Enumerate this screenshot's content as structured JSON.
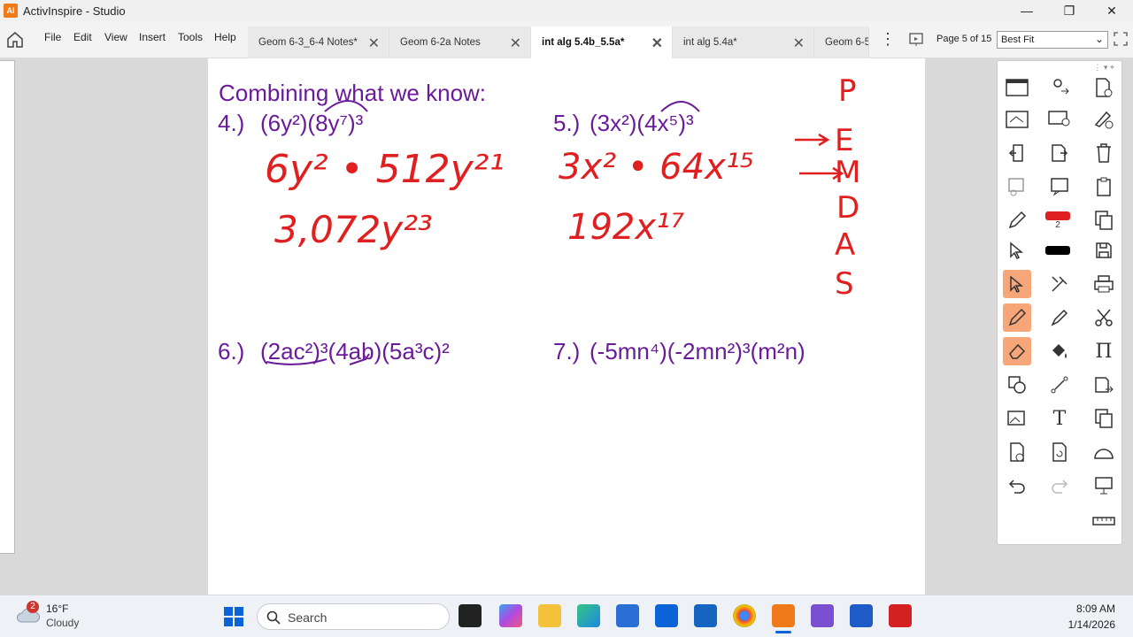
{
  "window": {
    "title": "ActivInspire - Studio",
    "logo_text": "AI"
  },
  "menu": [
    "File",
    "Edit",
    "View",
    "Insert",
    "Tools",
    "Help"
  ],
  "tabs": [
    {
      "label": "Geom 6-3_6-4 Notes*",
      "active": false
    },
    {
      "label": "Geom 6-2a Notes",
      "active": false
    },
    {
      "label": "int alg 5.4b_5.5a*",
      "active": true
    },
    {
      "label": "int alg 5.4a*",
      "active": false
    },
    {
      "label": "Geom 6-5",
      "active": false
    }
  ],
  "page_indicator": "Page 5 of 15",
  "zoom": "Best Fit",
  "flipchart": {
    "heading": "Combining what we know:",
    "problems": [
      {
        "num": "4.)",
        "expr": "(6y²)(8y⁷)³"
      },
      {
        "num": "5.)",
        "expr": "(3x²)(4x⁵)³"
      },
      {
        "num": "6.)",
        "expr": "(2ac²)³(4ab)(5a³c)²"
      },
      {
        "num": "7.)",
        "expr": "(-5mn⁴)(-2mn²)³(m²n)"
      }
    ],
    "handwritten": {
      "p4_step1": "6y² • 512y²¹",
      "p4_step2": "3,072y²³",
      "p5_step1": "3x² • 64x¹⁵",
      "p5_step2": "192x¹⁷",
      "pemdas": [
        "P",
        "E",
        "M",
        "D",
        "A",
        "S"
      ]
    }
  },
  "colors": {
    "typed_text": "#6a1b9a",
    "ink": "#e02020",
    "accent_tool": "#f7a67a"
  },
  "pen_width": "2",
  "taskbar": {
    "weather_temp": "16°F",
    "weather_desc": "Cloudy",
    "weather_badge": "2",
    "search_placeholder": "Search",
    "time": "8:09 AM",
    "date": "1/14/2026"
  }
}
